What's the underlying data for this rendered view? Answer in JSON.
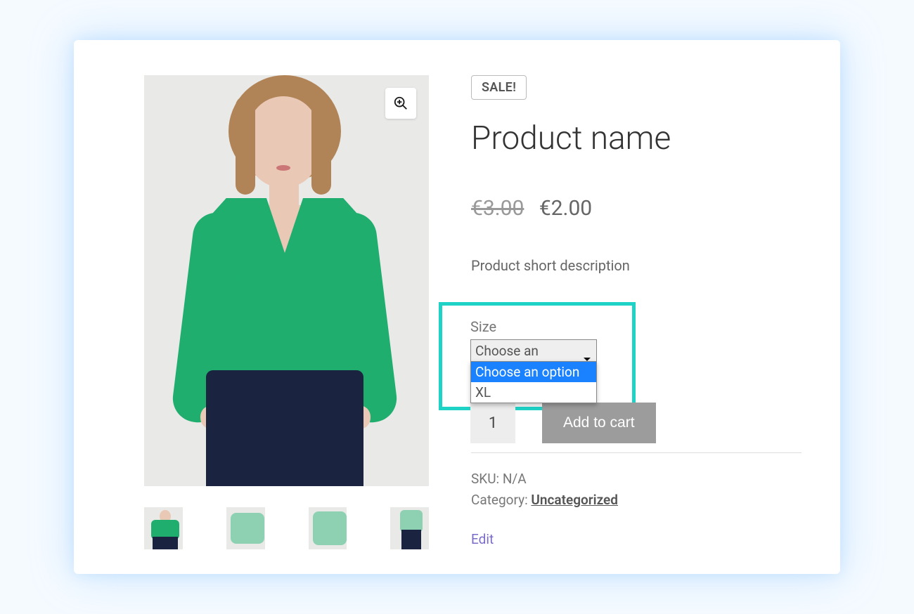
{
  "badge": {
    "sale": "SALE!"
  },
  "product": {
    "title": "Product name",
    "price_old": "€3.00",
    "price_new": "€2.00",
    "short_description": "Product short description"
  },
  "variation": {
    "label": "Size",
    "selected": "Choose an option",
    "options": [
      "Choose an option",
      "XL"
    ]
  },
  "cart": {
    "quantity": "1",
    "add_label": "Add to cart"
  },
  "meta": {
    "sku_label": "SKU:",
    "sku_value": "N/A",
    "category_label": "Category:",
    "category_value": "Uncategorized"
  },
  "edit_label": "Edit",
  "icons": {
    "zoom": "zoom-in-icon"
  },
  "colors": {
    "accent_highlight": "#1ed3c6",
    "dropdown_selected": "#1a82ff",
    "button_bg": "#9c9c9c",
    "shirt": "#1fae6e",
    "pants": "#1a2440"
  }
}
